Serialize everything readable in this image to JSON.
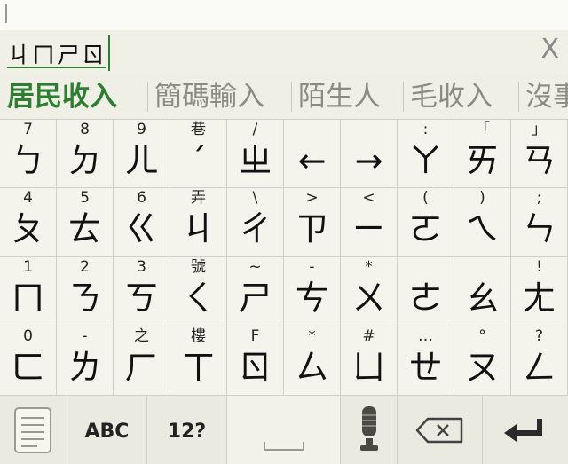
{
  "composing": {
    "text": "ㄐㄇㄕㄖ",
    "close_label": "X"
  },
  "candidates": [
    "居民收入",
    "簡碼輸入",
    "陌生人",
    "毛收入",
    "沒事"
  ],
  "rows": [
    [
      {
        "top": "7",
        "main": "ㄅ"
      },
      {
        "top": "8",
        "main": "ㄉ"
      },
      {
        "top": "9",
        "main": "ㄦ"
      },
      {
        "top": "巷",
        "main": "ˊ"
      },
      {
        "top": "/",
        "main": "ㄓ"
      },
      {
        "top": "",
        "main": "←"
      },
      {
        "top": "",
        "main": "→"
      },
      {
        "top": ":",
        "main": "ㄚ"
      },
      {
        "top": "「",
        "main": "ㄞ"
      },
      {
        "top": "」",
        "main": "ㄢ"
      }
    ],
    [
      {
        "top": "4",
        "main": "ㄆ"
      },
      {
        "top": "5",
        "main": "ㄊ"
      },
      {
        "top": "6",
        "main": "ㄍ"
      },
      {
        "top": "弄",
        "main": "ㄐ"
      },
      {
        "top": "\\",
        "main": "ㄔ"
      },
      {
        "top": ">",
        "main": "ㄗ"
      },
      {
        "top": "<",
        "main": "ㄧ"
      },
      {
        "top": "(",
        "main": "ㄛ"
      },
      {
        "top": ")",
        "main": "ㄟ"
      },
      {
        "top": ";",
        "main": "ㄣ"
      }
    ],
    [
      {
        "top": "1",
        "main": "ㄇ"
      },
      {
        "top": "2",
        "main": "ㄋ"
      },
      {
        "top": "3",
        "main": "ㄎ"
      },
      {
        "top": "號",
        "main": "ㄑ"
      },
      {
        "top": "~",
        "main": "ㄕ"
      },
      {
        "top": "-",
        "main": "ㄘ"
      },
      {
        "top": "*",
        "main": "ㄨ"
      },
      {
        "top": "",
        "main": "ㄜ"
      },
      {
        "top": "",
        "main": "ㄠ"
      },
      {
        "top": "!",
        "main": "ㄤ"
      }
    ],
    [
      {
        "top": "0",
        "main": "ㄈ"
      },
      {
        "top": "-",
        "main": "ㄌ"
      },
      {
        "top": "之",
        "main": "ㄏ"
      },
      {
        "top": "樓",
        "main": "ㄒ"
      },
      {
        "top": "F",
        "main": "ㄖ"
      },
      {
        "top": "*",
        "main": "ㄙ"
      },
      {
        "top": "#",
        "main": "ㄩ"
      },
      {
        "top": "…",
        "main": "ㄝ"
      },
      {
        "top": "°",
        "main": "ㄡ"
      },
      {
        "top": "?",
        "main": "ㄥ"
      }
    ]
  ],
  "bottom": {
    "abc_label": "ABC",
    "num_label": "12?"
  },
  "icons": {
    "menu": "notepad-icon",
    "space": "space-icon",
    "mic": "microphone-icon",
    "backspace": "backspace-icon",
    "enter": "enter-icon"
  },
  "colors": {
    "accent": "#2e7d32",
    "candidate_text": "#8b8b83",
    "key_bg": "#f4f4ec"
  }
}
